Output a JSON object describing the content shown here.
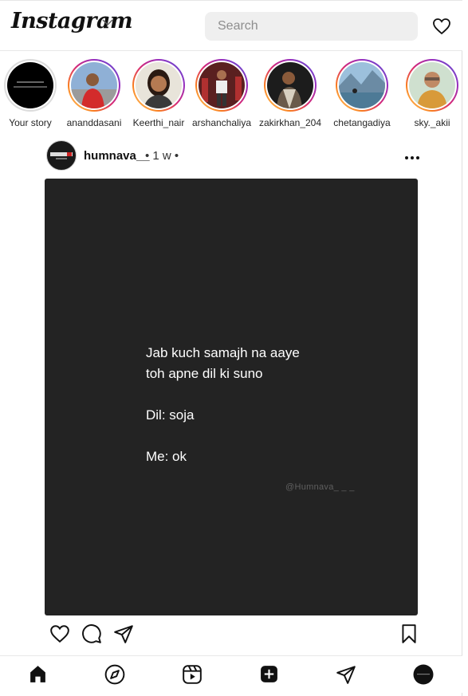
{
  "header": {
    "logo": "Instagram",
    "search_placeholder": "Search"
  },
  "stories": [
    {
      "name": "Your story",
      "own": true
    },
    {
      "name": "ananddasani"
    },
    {
      "name": "Keerthi_nair"
    },
    {
      "name": "arshanchaliya"
    },
    {
      "name": "zakirkhan_204"
    },
    {
      "name": "chetangadiya"
    },
    {
      "name": "sky._akii"
    }
  ],
  "post": {
    "username": "humnava__",
    "meta": "• 1 w •",
    "lines": [
      "Jab kuch samajh na aaye",
      "toh apne dil ki suno",
      "Dil: soja",
      "Me: ok"
    ],
    "watermark": "@Humnava_ _ _"
  },
  "icons": {
    "chevron": "chevron-down-icon",
    "notifications": "heart-icon",
    "more": "more-options-icon",
    "like": "heart-icon",
    "comment": "comment-icon",
    "share": "send-icon",
    "save": "bookmark-icon",
    "nav": [
      "home-icon",
      "explore-icon",
      "reels-icon",
      "create-icon",
      "messages-icon",
      "profile-icon"
    ]
  }
}
